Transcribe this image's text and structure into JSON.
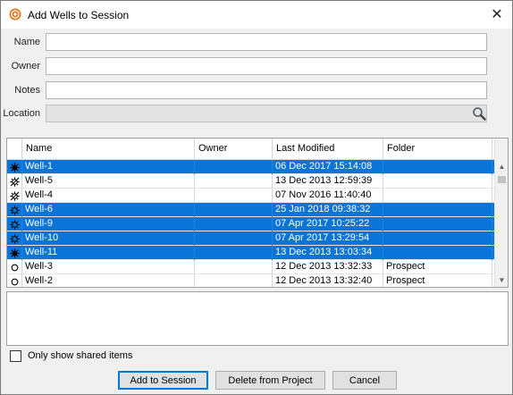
{
  "window": {
    "title": "Add Wells to Session",
    "app_icon": "orange-hexagon-icon",
    "close_label": "✕"
  },
  "form": {
    "name_label": "Name",
    "name_value": "",
    "owner_label": "Owner",
    "owner_value": "",
    "notes_label": "Notes",
    "notes_value": "",
    "location_label": "Location",
    "location_value": "",
    "location_icon": "magnifier-icon"
  },
  "table": {
    "columns": [
      "",
      "Name",
      "Owner",
      "Last Modified",
      "Folder"
    ],
    "rows": [
      {
        "icon": "well-gas-oil-icon",
        "name": "Well-1",
        "owner": "",
        "modified": "06 Dec 2017 15:14:08",
        "folder": "",
        "selected": true
      },
      {
        "icon": "well-injection-icon",
        "name": "Well-5",
        "owner": "",
        "modified": "13 Dec 2013 12:59:39",
        "folder": "",
        "selected": false
      },
      {
        "icon": "well-injection-icon",
        "name": "Well-4",
        "owner": "",
        "modified": "07 Nov 2016 11:40:40",
        "folder": "",
        "selected": false
      },
      {
        "icon": "well-gas-icon",
        "name": "Well-6",
        "owner": "",
        "modified": "25 Jan 2018 09:38:32",
        "folder": "",
        "selected": true
      },
      {
        "icon": "well-gas-icon",
        "name": "Well-9",
        "owner": "",
        "modified": "07 Apr 2017 10:25:22",
        "folder": "",
        "selected": true
      },
      {
        "icon": "well-gas-icon",
        "name": "Well-10",
        "owner": "",
        "modified": "07 Apr 2017 13:29:54",
        "folder": "",
        "selected": true
      },
      {
        "icon": "well-oil-icon",
        "name": "Well-11",
        "owner": "",
        "modified": "13 Dec 2013 13:03:34",
        "folder": "",
        "selected": true
      },
      {
        "icon": "well-location-icon",
        "name": "Well-3",
        "owner": "",
        "modified": "12 Dec 2013 13:32:33",
        "folder": "Prospect",
        "selected": false
      },
      {
        "icon": "well-location-icon",
        "name": "Well-2",
        "owner": "",
        "modified": "12 Dec 2013 13:32:40",
        "folder": "Prospect",
        "selected": false
      }
    ]
  },
  "options": {
    "shared_only_label": "Only show shared items",
    "shared_only_checked": false
  },
  "buttons": {
    "add_label": "Add to Session",
    "delete_label": "Delete from Project",
    "cancel_label": "Cancel"
  },
  "colors": {
    "selection": "#0a74d8",
    "app_icon": "#e5751f"
  }
}
